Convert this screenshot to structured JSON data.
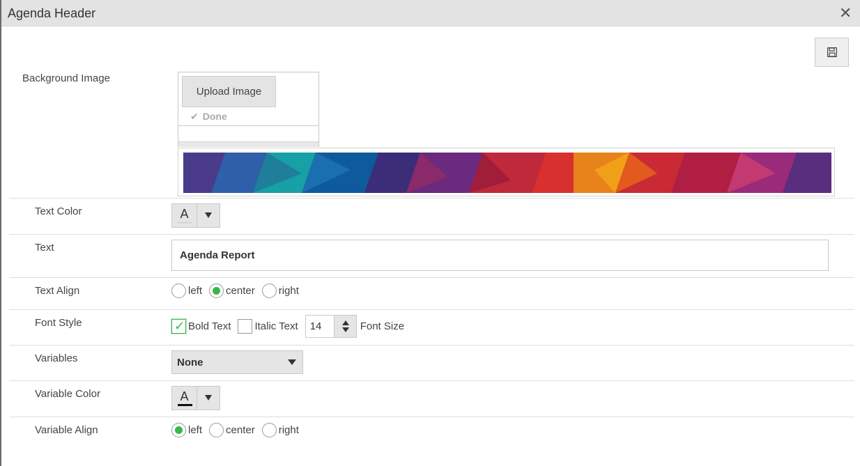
{
  "dialog": {
    "title": "Agenda Header",
    "close_icon": "close-icon",
    "save_icon": "save-icon"
  },
  "background_image": {
    "label": "Background Image",
    "upload_label": "Upload Image",
    "done_label": "Done",
    "done_icon": "check-icon"
  },
  "text_color": {
    "label": "Text Color",
    "glyph": "A",
    "swatch_color": "#d8d8d8"
  },
  "text": {
    "label": "Text",
    "value": "Agenda Report"
  },
  "text_align": {
    "label": "Text Align",
    "options": [
      "left",
      "center",
      "right"
    ],
    "selected": "center"
  },
  "font_style": {
    "label": "Font Style",
    "bold_label": "Bold Text",
    "bold_checked": true,
    "italic_label": "Italic Text",
    "italic_checked": false,
    "font_size_value": "14",
    "font_size_label": "Font Size"
  },
  "variables": {
    "label": "Variables",
    "selected": "None"
  },
  "variable_color": {
    "label": "Variable Color",
    "glyph": "A",
    "swatch_color": "#111111"
  },
  "variable_align": {
    "label": "Variable Align",
    "options": [
      "left",
      "center",
      "right"
    ],
    "selected": "left"
  },
  "colors": {
    "accent": "#3ab54a",
    "titlebar": "#e3e3e3"
  }
}
